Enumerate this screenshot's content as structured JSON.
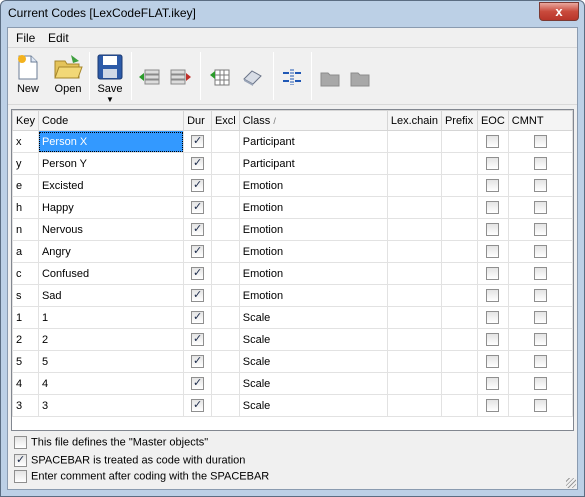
{
  "window": {
    "title": "Current Codes [LexCodeFLAT.ikey]",
    "close_label": "x"
  },
  "menu": {
    "file": "File",
    "edit": "Edit"
  },
  "toolbar": {
    "new_label": "New",
    "open_label": "Open",
    "save_label": "Save"
  },
  "table": {
    "headers": [
      "Key",
      "Code",
      "Dur",
      "Excl",
      "Class",
      "Lex.chain",
      "Prefix",
      "EOC",
      "CMNT"
    ],
    "sort_indicator": "/",
    "rows": [
      {
        "key": "x",
        "code": "Person X",
        "dur": true,
        "class": "Participant"
      },
      {
        "key": "y",
        "code": "Person Y",
        "dur": true,
        "class": "Participant"
      },
      {
        "key": "e",
        "code": "Excisted",
        "dur": true,
        "class": "Emotion"
      },
      {
        "key": "h",
        "code": "Happy",
        "dur": true,
        "class": "Emotion"
      },
      {
        "key": "n",
        "code": "Nervous",
        "dur": true,
        "class": "Emotion"
      },
      {
        "key": "a",
        "code": "Angry",
        "dur": true,
        "class": "Emotion"
      },
      {
        "key": "c",
        "code": "Confused",
        "dur": true,
        "class": "Emotion"
      },
      {
        "key": "s",
        "code": "Sad",
        "dur": true,
        "class": "Emotion"
      },
      {
        "key": "1",
        "code": "1",
        "dur": true,
        "class": "Scale"
      },
      {
        "key": "2",
        "code": "2",
        "dur": true,
        "class": "Scale"
      },
      {
        "key": "5",
        "code": "5",
        "dur": true,
        "class": "Scale"
      },
      {
        "key": "4",
        "code": "4",
        "dur": true,
        "class": "Scale"
      },
      {
        "key": "3",
        "code": "3",
        "dur": true,
        "class": "Scale"
      }
    ]
  },
  "options": {
    "master_label": "This file defines the \"Master objects\"",
    "master_checked": false,
    "spacebar_label": "SPACEBAR is treated as code with duration",
    "spacebar_checked": true,
    "comment_label": "Enter comment after coding with the SPACEBAR",
    "comment_checked": false
  },
  "colors": {
    "selection": "#3399ff",
    "frame": "#bcd0e6"
  }
}
